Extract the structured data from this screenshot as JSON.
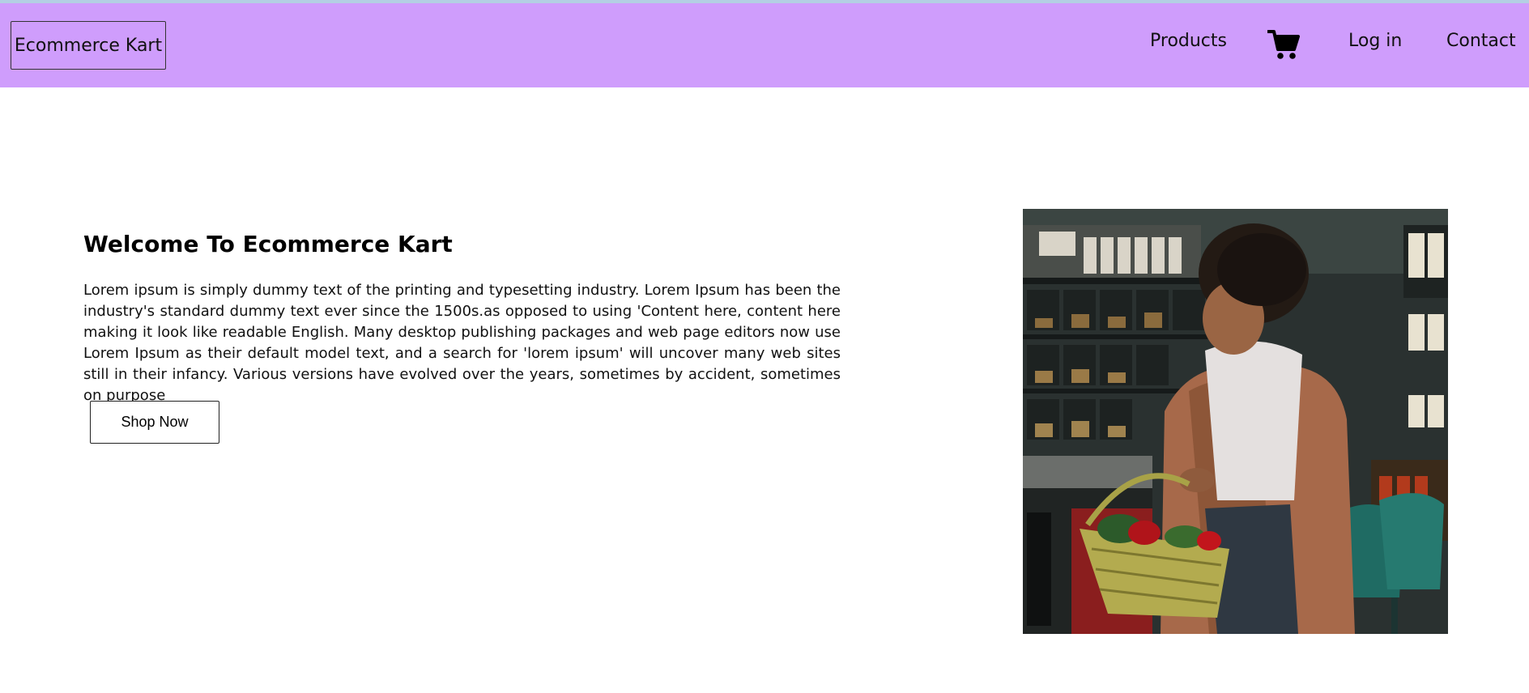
{
  "navbar": {
    "brand": "Ecommerce Kart",
    "links": {
      "products": "Products",
      "login": "Log in",
      "contact": "Contact"
    },
    "cart_icon": "shopping-cart-icon",
    "background": "#cf9dfc"
  },
  "hero": {
    "title": "Welcome To Ecommerce Kart",
    "description": "Lorem ipsum is simply dummy text of the printing and typesetting industry. Lorem Ipsum has been the industry's standard dummy text ever since the 1500s.as opposed to using 'Content here, content here making it look like readable English. Many desktop publishing packages and web page editors now use Lorem Ipsum as their default model text, and a search for 'lorem ipsum' will uncover many web sites still in their infancy. Various versions have evolved over the years, sometimes by accident, sometimes on purpose",
    "cta": "Shop Now",
    "image": "woman-shopping-with-basket-photo"
  }
}
